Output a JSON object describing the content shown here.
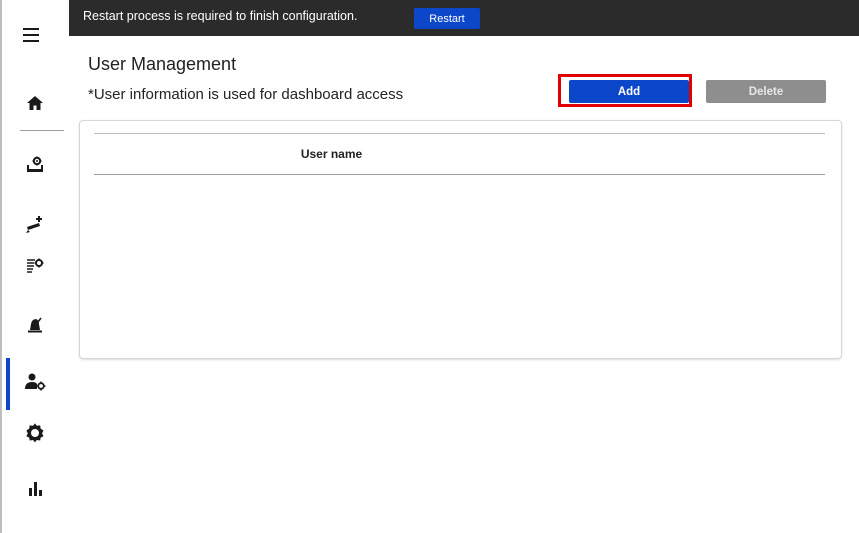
{
  "topbar": {
    "message": "Restart process is required to finish configuration.",
    "restart_label": "Restart"
  },
  "sidebar": {
    "items": [
      {
        "name": "home",
        "icon": "home-icon"
      },
      {
        "name": "device-settings",
        "icon": "device-settings-icon"
      },
      {
        "name": "add-device",
        "icon": "add-device-icon"
      },
      {
        "name": "list-settings",
        "icon": "list-settings-icon"
      },
      {
        "name": "alert",
        "icon": "alert-icon"
      },
      {
        "name": "user-management",
        "icon": "user-settings-icon",
        "active": true
      },
      {
        "name": "settings",
        "icon": "gear-icon"
      },
      {
        "name": "statistics",
        "icon": "bar-chart-icon"
      }
    ]
  },
  "page": {
    "title": "User Management",
    "subtitle": "*User information is used for dashboard access"
  },
  "actions": {
    "add_label": "Add",
    "delete_label": "Delete"
  },
  "table": {
    "columns": [
      "User name"
    ],
    "rows": []
  },
  "colors": {
    "accent": "#0d47c9",
    "topbar": "#2b2b2b",
    "disabled": "#8e8e8e",
    "highlight": "#e00000"
  }
}
